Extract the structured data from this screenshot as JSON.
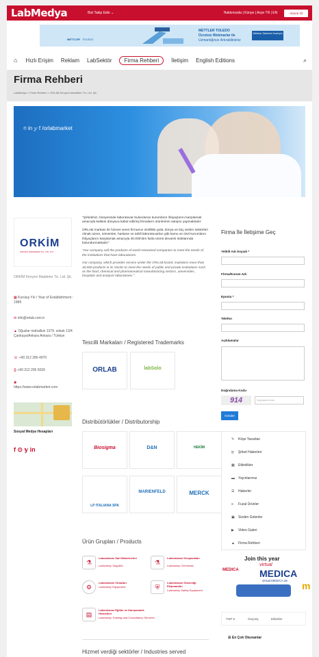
{
  "topbar": {
    "logo": "LabMedya",
    "follow": "Bizi Takip Edin ⌄",
    "links": "Hakkımızda | Künye | Arşiv    TR | EN",
    "signup_label": "Abone Ol"
  },
  "ad": {
    "brand1": "METTLER",
    "brand2": "TOLEDO",
    "title1": "METTLER TOLEDO",
    "title2": "Ücretsiz Webinarlar ile",
    "title3": "Uzmanlığınızı Artırabilirsiniz",
    "btn": "Webinar Takvimini İnceleyin"
  },
  "nav": {
    "items": [
      "Hızlı Erişim",
      "Reklam",
      "LabSektör",
      "Firma Rehberi",
      "İletişim",
      "English Editions"
    ]
  },
  "page": {
    "title": "Firma Rehberi",
    "breadcrumb": "LabMedya  >  Firma Rehberi  >  ORLAB Kimyevi Maddeler Tic. Ltd. Şti."
  },
  "banner": {
    "social": "⌾ in 𝕪 f /orlabmarket"
  },
  "company": {
    "logo_text": "ORKİM",
    "logo_sub": "KİMYEVİ MADDELER TİC. LTD. ŞTİ.",
    "name": "ORKİM Kimyevi Maddeler Tic. Ltd. Şti.",
    "founded": "Kuruluş Yılı / Year of Establishment : 1989",
    "email": "info@orlab.com.tr",
    "address": "Oğuzlar mahallesi 1379. sokak 13/4 Çankaya/Ankara Ankara / Türkiye",
    "phone": "+90 312 286 4070",
    "fax": "+90 312 205 5030",
    "website": "https://www.orlabmarket.com",
    "social_title": "Sosyal Medya Hesapları",
    "social_icons": "f ⊙ 𝕪 in"
  },
  "intro": {
    "p1": "\"Şirketimiz, bünyesinde laboratuvar bulunduran kurumların ihtiyaçlarını karşılamak amacıyla kalitesi dünyaca kabul edilmiş firmaların ürünlerinin satışını yapmaktadır.",
    "p2": "ORLAB markası ile hizmet veren firmamız özellikle gıda, kimya ve ilaç üretim sektörleri olmak üzere, üniversite, hastane ve tahlil laboratuvarları gibi kamu ve özel kurumların ihtiyaçlarını karşılamak amacıyla 40.000'den fazla ürünü devamlı stoklarında bulundurmaktadır.\"",
    "p3": "\"Our company sell the products of world-renowned companies to meet the needs of the institutions that have laboratories.",
    "p4": "Our company, which provides service under the ORLAB brand, maintains more than 40,000 products in its stocks to meet the needs of public and private institutions such as the food, chemical and pharmaceutical manufacturing sectors, universities, hospitals and analysis laboratories.\""
  },
  "sections": {
    "trademarks": "Tescilli Markaları / Registered Trademarks",
    "distributors": "Distribütörlükler / Distributorship",
    "products": "Ürün Grupları / Products",
    "bottom": "Hizmet verdiği sektörler / Industries served"
  },
  "trademarks": [
    "ORLAB",
    "labSolo"
  ],
  "distributors": [
    "Biosigma",
    "D&N",
    "HEKİM",
    "LP ITALIANA SPA",
    "MARIENFELD",
    "MERCK"
  ],
  "products": [
    {
      "tr": "Laboratuvar Sarf Malzemeleri",
      "en": "Laboratory Supplies"
    },
    {
      "tr": "Laboratuvar Kimyasalları",
      "en": "Laboratory Chemicals"
    },
    {
      "tr": "Laboratuvar Cihazları",
      "en": "Laboratory Equipment"
    },
    {
      "tr": "Laboratuvar Güvenliği Ekipmanları",
      "en": "Laboratory Safety Equipment"
    },
    {
      "tr": "Laboratuvar Eğitim ve Danışmanlık Hizmetleri",
      "en": "Laboratory Training and Consultancy Services"
    }
  ],
  "form": {
    "title": "Firma İle İletişime Geç",
    "name_label": "Yetkili Adı Soyadı *",
    "company_label": "Firma/Kurum Adı",
    "email_label": "Eposta *",
    "phone_label": "Telefon",
    "notes_label": "Açıklamalar",
    "captcha_label": "Doğrulama Kodu",
    "captcha_code": "914",
    "captcha_placeholder": "Doğrulama Kodu",
    "submit": "Gönder"
  },
  "menu": [
    "Köşe Yazarları",
    "Şirket Haberleri",
    "Etkinlikler",
    "Yayınlarımız",
    "Haberler",
    "Fuzal Ürünler",
    "Sizden Gelenler",
    "Video Galeri",
    "Firma Rehberi"
  ],
  "side_ad": {
    "line1": "Join this year",
    "line2": "virtual",
    "line3": "MEDICA",
    "line4": "virtual.MEDICA.de",
    "brand": "MEDICA"
  },
  "tabs": [
    "TOP 5",
    "Geçmiş",
    "Etiketler"
  ],
  "most_read": "En Çok Okunanlar",
  "colors": {
    "brand": "#c8102e",
    "accent": "#1e7bd8"
  }
}
